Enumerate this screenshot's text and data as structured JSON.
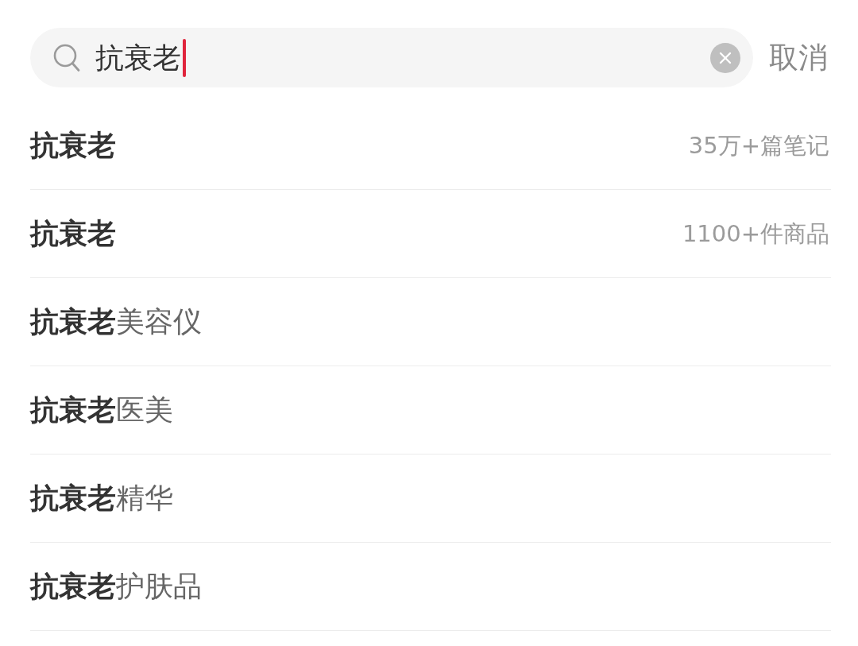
{
  "search": {
    "value": "抗衰老",
    "focused": true,
    "cancel": "取消"
  },
  "suggestions": [
    {
      "kind": "stat",
      "text": "抗衰老",
      "meta": "35万+篇笔记"
    },
    {
      "kind": "stat",
      "text": "抗衰老",
      "meta": "1100+件商品"
    },
    {
      "kind": "completion",
      "text": "**抗衰老**美容仪"
    },
    {
      "kind": "completion",
      "text": "**抗衰老**医美"
    },
    {
      "kind": "completion",
      "text": "**抗衰老**精华"
    },
    {
      "kind": "completion",
      "text": "**抗衰老**护肤品"
    }
  ]
}
